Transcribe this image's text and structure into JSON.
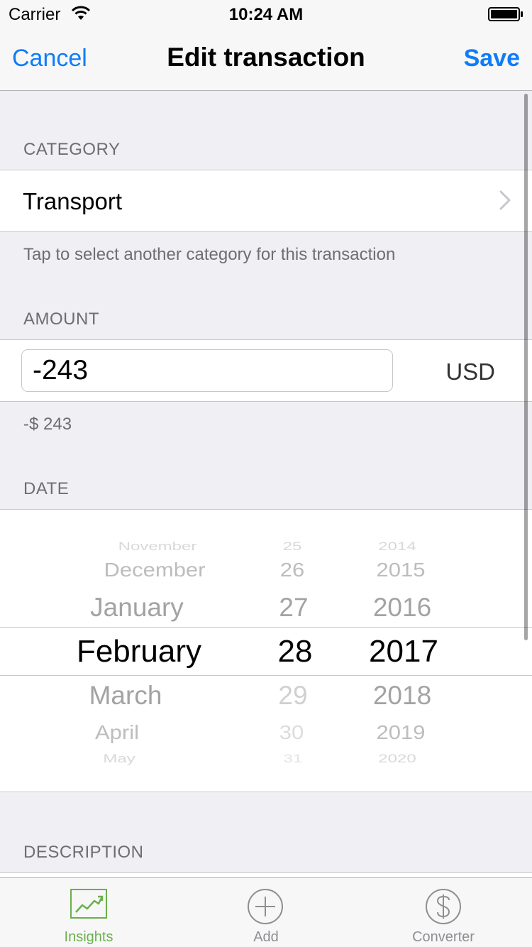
{
  "status_bar": {
    "carrier": "Carrier",
    "time": "10:24 AM"
  },
  "nav": {
    "cancel_label": "Cancel",
    "title": "Edit transaction",
    "save_label": "Save"
  },
  "category": {
    "header": "CATEGORY",
    "value": "Transport",
    "footer": "Tap to select another category for this transaction"
  },
  "amount": {
    "header": "AMOUNT",
    "value": "-243",
    "currency": "USD",
    "formatted": "-$ 243"
  },
  "date": {
    "header": "DATE",
    "months": [
      "November",
      "December",
      "January",
      "February",
      "March",
      "April",
      "May"
    ],
    "days": [
      "25",
      "26",
      "27",
      "28",
      "29",
      "30",
      "31"
    ],
    "years": [
      "2014",
      "2015",
      "2016",
      "2017",
      "2018",
      "2019",
      "2020"
    ],
    "selected": {
      "month": "February",
      "day": "28",
      "year": "2017"
    }
  },
  "description": {
    "header": "DESCRIPTION"
  },
  "tabs": [
    {
      "label": "Insights",
      "icon": "chart-icon",
      "active": true
    },
    {
      "label": "Add",
      "icon": "plus-circle-icon",
      "active": false
    },
    {
      "label": "Converter",
      "icon": "dollar-circle-icon",
      "active": false
    }
  ],
  "colors": {
    "accent": "#0f7cf8",
    "tab_active": "#6ab04c",
    "tab_inactive": "#8e8e93"
  }
}
